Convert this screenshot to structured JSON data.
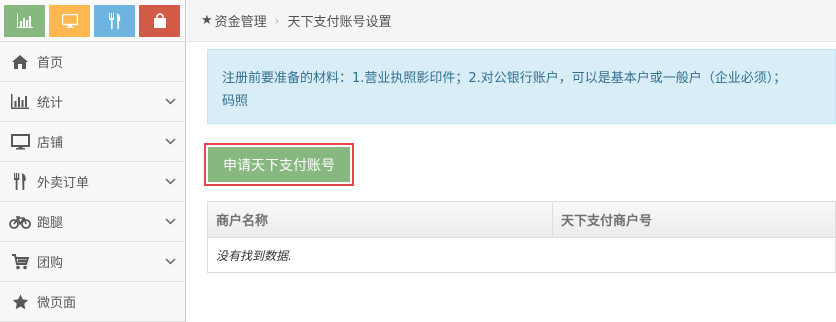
{
  "shortcuts": [
    {
      "name": "stats-shortcut",
      "icon": "bar-chart-icon",
      "color": "#87b87f"
    },
    {
      "name": "shop-shortcut",
      "icon": "monitor-icon",
      "color": "#ffb752"
    },
    {
      "name": "takeout-shortcut",
      "icon": "cutlery-icon",
      "color": "#6fb3e0"
    },
    {
      "name": "shopping-shortcut",
      "icon": "shopping-bag-icon",
      "color": "#d15b47"
    }
  ],
  "sidebar": {
    "items": [
      {
        "label": "首页",
        "icon": "home-icon",
        "has_arrow": false
      },
      {
        "label": "统计",
        "icon": "bar-chart-icon",
        "has_arrow": true
      },
      {
        "label": "店铺",
        "icon": "monitor-icon",
        "has_arrow": true
      },
      {
        "label": "外卖订单",
        "icon": "cutlery-icon",
        "has_arrow": true
      },
      {
        "label": "跑腿",
        "icon": "bicycle-icon",
        "has_arrow": true
      },
      {
        "label": "团购",
        "icon": "cart-icon",
        "has_arrow": true
      },
      {
        "label": "微页面",
        "icon": "star-icon",
        "has_arrow": false
      }
    ]
  },
  "breadcrumb": {
    "star": "★",
    "parent": "资金管理",
    "separator": "›",
    "current": "天下支付账号设置"
  },
  "notice": {
    "line1": "注册前要准备的材料：1.营业执照影印件；2.对公银行账户，可以是基本户或一般户（企业必须）；",
    "line2": "码照"
  },
  "apply_button": {
    "label": "申请天下支付账号"
  },
  "table": {
    "columns": [
      "商户名称",
      "天下支付商户号"
    ],
    "empty_text": "没有找到数据."
  },
  "colors": {
    "accent_green": "#87b87f",
    "link_blue": "#4c8fbd",
    "notice_bg": "#d9edf7",
    "highlight_red": "#e04848"
  }
}
